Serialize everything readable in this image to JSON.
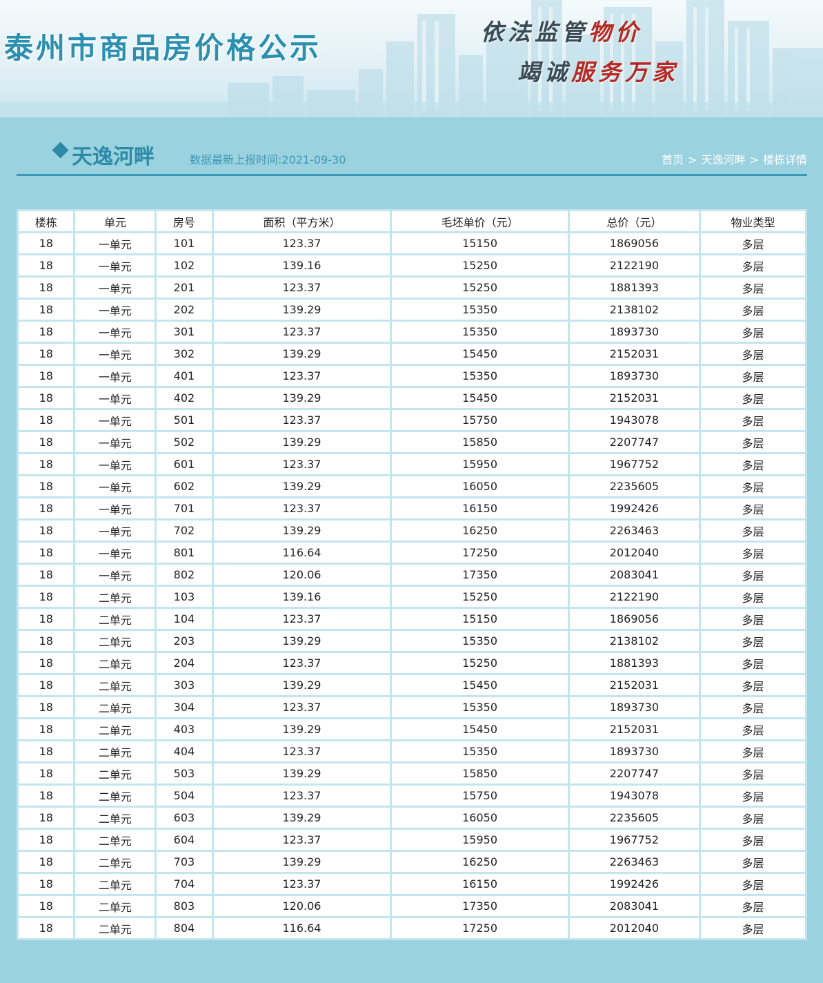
{
  "banner": {
    "site_title": "泰州市商品房价格公示",
    "slogan_line1_a": "依法监管",
    "slogan_line1_b": "物价",
    "slogan_line2_a": "竭诚",
    "slogan_line2_b": "服务万家"
  },
  "header": {
    "building_name": "天逸河畔",
    "update_time": "数据最新上报时间:2021-09-30",
    "breadcrumb": [
      {
        "label": "首页"
      },
      {
        "label": "天逸河畔"
      },
      {
        "label": "楼栋详情"
      }
    ],
    "breadcrumb_separator": ">"
  },
  "table": {
    "columns": [
      "楼栋",
      "单元",
      "房号",
      "面积（平方米）",
      "毛坯单价（元）",
      "总价（元）",
      "物业类型"
    ],
    "rows": [
      [
        "18",
        "一单元",
        "101",
        "123.37",
        "15150",
        "1869056",
        "多层"
      ],
      [
        "18",
        "一单元",
        "102",
        "139.16",
        "15250",
        "2122190",
        "多层"
      ],
      [
        "18",
        "一单元",
        "201",
        "123.37",
        "15250",
        "1881393",
        "多层"
      ],
      [
        "18",
        "一单元",
        "202",
        "139.29",
        "15350",
        "2138102",
        "多层"
      ],
      [
        "18",
        "一单元",
        "301",
        "123.37",
        "15350",
        "1893730",
        "多层"
      ],
      [
        "18",
        "一单元",
        "302",
        "139.29",
        "15450",
        "2152031",
        "多层"
      ],
      [
        "18",
        "一单元",
        "401",
        "123.37",
        "15350",
        "1893730",
        "多层"
      ],
      [
        "18",
        "一单元",
        "402",
        "139.29",
        "15450",
        "2152031",
        "多层"
      ],
      [
        "18",
        "一单元",
        "501",
        "123.37",
        "15750",
        "1943078",
        "多层"
      ],
      [
        "18",
        "一单元",
        "502",
        "139.29",
        "15850",
        "2207747",
        "多层"
      ],
      [
        "18",
        "一单元",
        "601",
        "123.37",
        "15950",
        "1967752",
        "多层"
      ],
      [
        "18",
        "一单元",
        "602",
        "139.29",
        "16050",
        "2235605",
        "多层"
      ],
      [
        "18",
        "一单元",
        "701",
        "123.37",
        "16150",
        "1992426",
        "多层"
      ],
      [
        "18",
        "一单元",
        "702",
        "139.29",
        "16250",
        "2263463",
        "多层"
      ],
      [
        "18",
        "一单元",
        "801",
        "116.64",
        "17250",
        "2012040",
        "多层"
      ],
      [
        "18",
        "一单元",
        "802",
        "120.06",
        "17350",
        "2083041",
        "多层"
      ],
      [
        "18",
        "二单元",
        "103",
        "139.16",
        "15250",
        "2122190",
        "多层"
      ],
      [
        "18",
        "二单元",
        "104",
        "123.37",
        "15150",
        "1869056",
        "多层"
      ],
      [
        "18",
        "二单元",
        "203",
        "139.29",
        "15350",
        "2138102",
        "多层"
      ],
      [
        "18",
        "二单元",
        "204",
        "123.37",
        "15250",
        "1881393",
        "多层"
      ],
      [
        "18",
        "二单元",
        "303",
        "139.29",
        "15450",
        "2152031",
        "多层"
      ],
      [
        "18",
        "二单元",
        "304",
        "123.37",
        "15350",
        "1893730",
        "多层"
      ],
      [
        "18",
        "二单元",
        "403",
        "139.29",
        "15450",
        "2152031",
        "多层"
      ],
      [
        "18",
        "二单元",
        "404",
        "123.37",
        "15350",
        "1893730",
        "多层"
      ],
      [
        "18",
        "二单元",
        "503",
        "139.29",
        "15850",
        "2207747",
        "多层"
      ],
      [
        "18",
        "二单元",
        "504",
        "123.37",
        "15750",
        "1943078",
        "多层"
      ],
      [
        "18",
        "二单元",
        "603",
        "139.29",
        "16050",
        "2235605",
        "多层"
      ],
      [
        "18",
        "二单元",
        "604",
        "123.37",
        "15950",
        "1967752",
        "多层"
      ],
      [
        "18",
        "二单元",
        "703",
        "139.29",
        "16250",
        "2263463",
        "多层"
      ],
      [
        "18",
        "二单元",
        "704",
        "123.37",
        "16150",
        "1992426",
        "多层"
      ],
      [
        "18",
        "二单元",
        "803",
        "120.06",
        "17350",
        "2083041",
        "多层"
      ],
      [
        "18",
        "二单元",
        "804",
        "116.64",
        "17250",
        "2012040",
        "多层"
      ]
    ]
  },
  "colors": {
    "page_background": "#9bd2e0",
    "accent": "#2c8aa6",
    "table_border": "#c3e5ef",
    "slogan_red": "#b52a22"
  },
  "icons": {
    "title_marker": "diamond-icon",
    "banner_backdrop": "city-skyline-image"
  }
}
